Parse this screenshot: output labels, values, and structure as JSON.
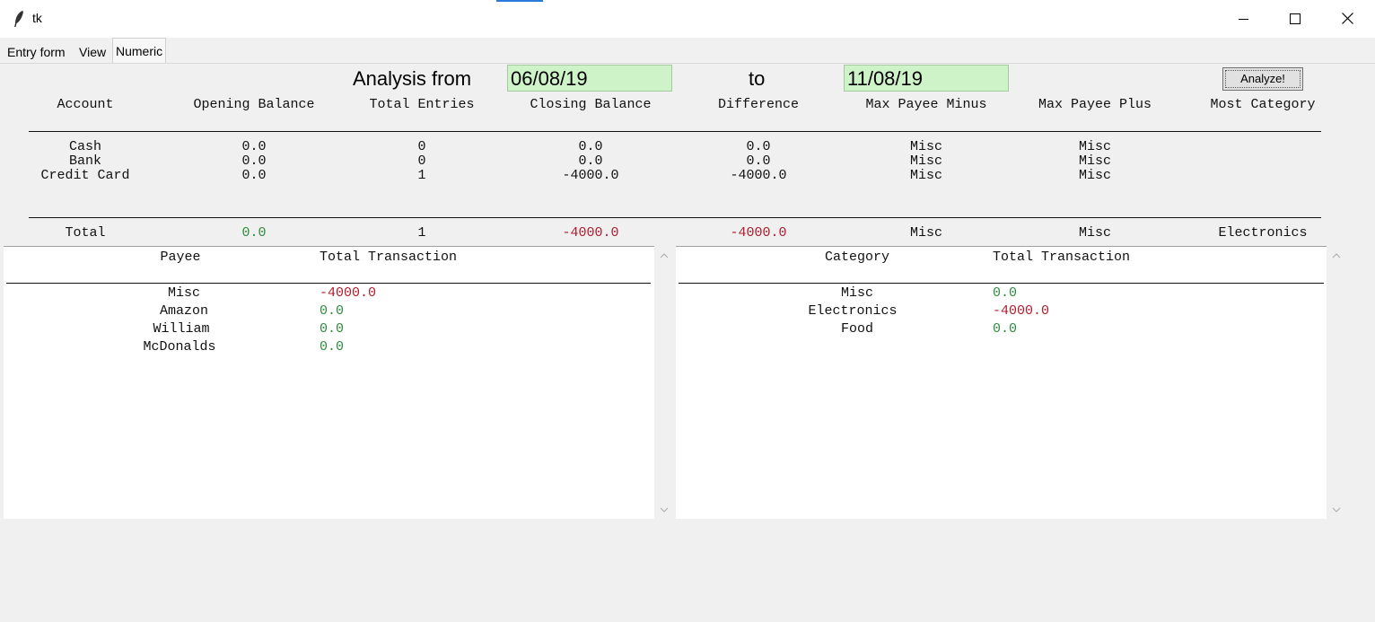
{
  "window": {
    "title": "tk"
  },
  "tabs": [
    "Entry form",
    "View",
    "Numeric"
  ],
  "analysis": {
    "from_label": "Analysis from",
    "from_value": "06/08/19",
    "to_label": "to",
    "to_value": "11/08/19",
    "button_label": "Analyze!"
  },
  "accounts_table": {
    "headers": [
      "Account",
      "Opening Balance",
      "Total Entries",
      "Closing Balance",
      "Difference",
      "Max Payee Minus",
      "Max Payee Plus",
      "Most Category"
    ],
    "rows": [
      [
        "Cash",
        "0.0",
        "0",
        "0.0",
        "0.0",
        "Misc",
        "Misc",
        ""
      ],
      [
        "Bank",
        "0.0",
        "0",
        "0.0",
        "0.0",
        "Misc",
        "Misc",
        ""
      ],
      [
        "Credit Card",
        "0.0",
        "1",
        "-4000.0",
        "-4000.0",
        "Misc",
        "Misc",
        ""
      ]
    ],
    "total": [
      "Total",
      "0.0",
      "1",
      "-4000.0",
      "-4000.0",
      "Misc",
      "Misc",
      "Electronics"
    ]
  },
  "payee_panel": {
    "headers": [
      "Payee",
      "Total Transaction"
    ],
    "rows": [
      {
        "name": "Misc",
        "value": "-4000.0",
        "sign": "neg"
      },
      {
        "name": "Amazon",
        "value": "0.0",
        "sign": "zero"
      },
      {
        "name": "William",
        "value": "0.0",
        "sign": "zero"
      },
      {
        "name": "McDonalds",
        "value": "0.0",
        "sign": "zero"
      }
    ]
  },
  "category_panel": {
    "headers": [
      "Category",
      "Total Transaction"
    ],
    "rows": [
      {
        "name": "Misc",
        "value": "0.0",
        "sign": "zero"
      },
      {
        "name": "Electronics",
        "value": "-4000.0",
        "sign": "neg"
      },
      {
        "name": "Food",
        "value": "0.0",
        "sign": "zero"
      }
    ]
  },
  "colors": {
    "positive_zero": "#2e8b3d",
    "negative": "#b01c2e",
    "date_field": "#cff3c9"
  }
}
